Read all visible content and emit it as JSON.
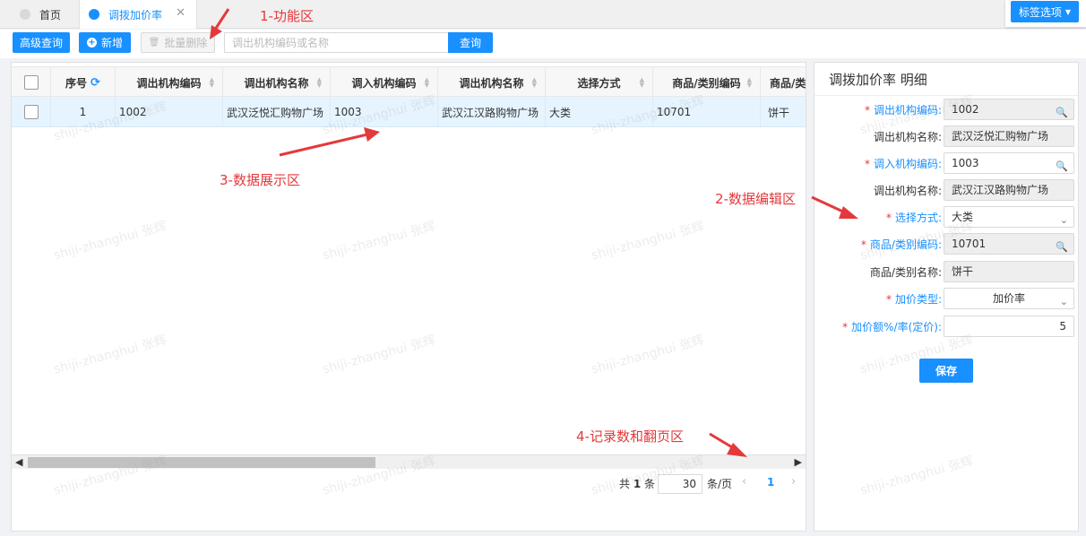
{
  "tabs": [
    {
      "label": "首页",
      "active": false
    },
    {
      "label": "调拨加价率",
      "active": true
    }
  ],
  "tag_options_label": "标签选项",
  "toolbar": {
    "advanced_query_label": "高级查询",
    "new_label": "新增",
    "batch_delete_label": "批量删除",
    "search_placeholder": "调出机构编码或名称",
    "query_label": "查询"
  },
  "grid": {
    "columns": [
      "",
      "序号",
      "调出机构编码",
      "调出机构名称",
      "调入机构编码",
      "调出机构名称",
      "选择方式",
      "商品/类别编码",
      "商品/类"
    ],
    "rows": [
      {
        "index": "1",
        "out_code": "1002",
        "out_name": "武汉泛悦汇购物广场",
        "in_code": "1003",
        "in_name": "武汉江汉路购物广场",
        "select_mode": "大类",
        "item_code": "10701",
        "item_name": "饼干"
      }
    ]
  },
  "pager": {
    "total_prefix": "共",
    "total_count": "1",
    "total_suffix": "条",
    "page_size": "30",
    "page_unit": "条/页",
    "current_page": "1"
  },
  "detail": {
    "title": "调拨加价率 明细",
    "fields": [
      {
        "label": "调出机构编码:",
        "value": "1002",
        "required": true
      },
      {
        "label": "调出机构名称:",
        "value": "武汉泛悦汇购物广场",
        "required": false
      },
      {
        "label": "调入机构编码:",
        "value": "1003",
        "required": true
      },
      {
        "label": "调出机构名称:",
        "value": "武汉江汉路购物广场",
        "required": false
      },
      {
        "label": "选择方式:",
        "value": "大类",
        "required": true
      },
      {
        "label": "商品/类别编码:",
        "value": "10701",
        "required": true
      },
      {
        "label": "商品/类别名称:",
        "value": "饼干",
        "required": false
      },
      {
        "label": "加价类型:",
        "value": "加价率",
        "required": true
      },
      {
        "label": "加价额%/率(定价):",
        "value": "5",
        "required": true
      }
    ],
    "save_label": "保存",
    "required_mark": "*"
  },
  "annotations": {
    "a1": "1-功能区",
    "a2": "2-数据编辑区",
    "a3": "3-数据展示区",
    "a4": "4-记录数和翻页区"
  },
  "watermark": "shiji-zhanghui 张辉",
  "colors": {
    "primary": "#1890ff",
    "annotation": "#e4393c",
    "selected_row": "#e6f4ff"
  }
}
